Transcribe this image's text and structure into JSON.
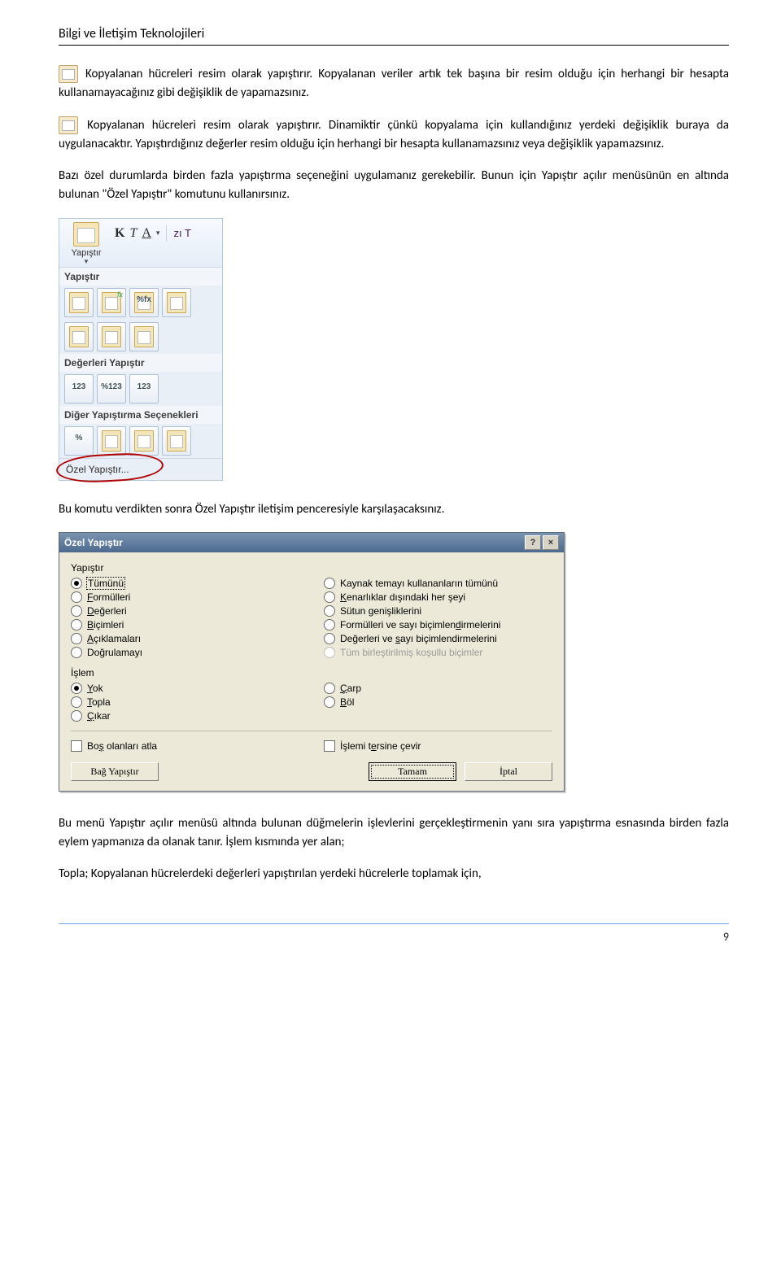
{
  "header": {
    "title": "Bilgi ve İletişim Teknolojileri"
  },
  "para1_icon_text": "Kopyalanan hücreleri resim olarak yapıştırır. Kopyalanan veriler artık tek başına bir resim olduğu için herhangi bir hesapta kullanamayacağınız gibi değişiklik de yapamazsınız.",
  "para2_icon_text": "Kopyalanan hücreleri resim olarak yapıştırır. Dinamiktir çünkü kopyalama için kullandığınız yerdeki değişiklik buraya da uygulanacaktır. Yapıştırdığınız değerler resim olduğu için herhangi bir hesapta kullanamazsınız veya değişiklik yapamazsınız.",
  "para3": "Bazı özel durumlarda birden fazla yapıştırma seçeneğini uygulamanız gerekebilir. Bunun için Yapıştır açılır menüsünün en altında bulunan \"Özel Yapıştır\" komutunu kullanırsınız.",
  "paste_dropdown": {
    "big_label": "Yapıştır",
    "fmt_right": "zı T",
    "section1": "Yapıştır",
    "section2": "Değerleri Yapıştır",
    "section3": "Diğer Yapıştırma Seçenekleri",
    "special": "Özel Yapıştır..."
  },
  "para4": "Bu komutu verdikten sonra Özel Yapıştır iletişim penceresiyle karşılaşacaksınız.",
  "dialog": {
    "title": "Özel Yapıştır",
    "grp_paste": "Yapıştır",
    "left": {
      "all": "Tümünü",
      "formulas_pre": "F",
      "formulas_rest": "ormülleri",
      "values_pre": "D",
      "values_rest": "eğerleri",
      "formats_pre": "B",
      "formats_rest": "içimleri",
      "comments_pre": "A",
      "comments_rest": "çıklamaları",
      "validation_pre": "Do",
      "validation_u": "ğ",
      "validation_rest": "rulamayı"
    },
    "right": {
      "theme": "Kaynak temayı kullananların tümünü",
      "borders_pre": "K",
      "borders_rest": "enarlıklar dışındaki her şeyi",
      "widths": "Sütun genişliklerini",
      "fmt_num_pre": "Formülleri ve sayı biçimlen",
      "fmt_num_u": "d",
      "fmt_num_rest": "irmelerini",
      "val_num_pre": "Değerleri ve ",
      "val_num_u": "s",
      "val_num_rest": "ayı biçimlendirmelerini",
      "cond": "Tüm birleştirilmiş koşullu biçimler"
    },
    "grp_op": "İşlem",
    "ops_left": {
      "none_u": "Y",
      "none_rest": "ok",
      "add_u": "T",
      "add_rest": "opla",
      "sub_u": "Ç",
      "sub_rest": "ıkar"
    },
    "ops_right": {
      "mul_u": "Ç",
      "mul_rest": "arp",
      "div_u": "B",
      "div_rest": "öl"
    },
    "skip_pre": "Bo",
    "skip_u": "ş",
    "skip_rest": " olanları atla",
    "transpose_pre": "İşlemi t",
    "transpose_u": "e",
    "transpose_rest": "rsine çevir",
    "btn_link_pre": "Ba",
    "btn_link_u": "ğ",
    "btn_link_rest": " Yapıştır",
    "btn_ok": "Tamam",
    "btn_cancel": "İptal"
  },
  "para5": "Bu menü Yapıştır açılır menüsü altında bulunan düğmelerin işlevlerini gerçekleştirmenin yanı sıra yapıştırma esnasında birden fazla eylem yapmanıza da olanak tanır. İşlem kısmında yer alan;",
  "para6": "Topla; Kopyalanan hücrelerdeki değerleri yapıştırılan yerdeki hücrelerle toplamak için,",
  "footer": {
    "page": "9"
  }
}
